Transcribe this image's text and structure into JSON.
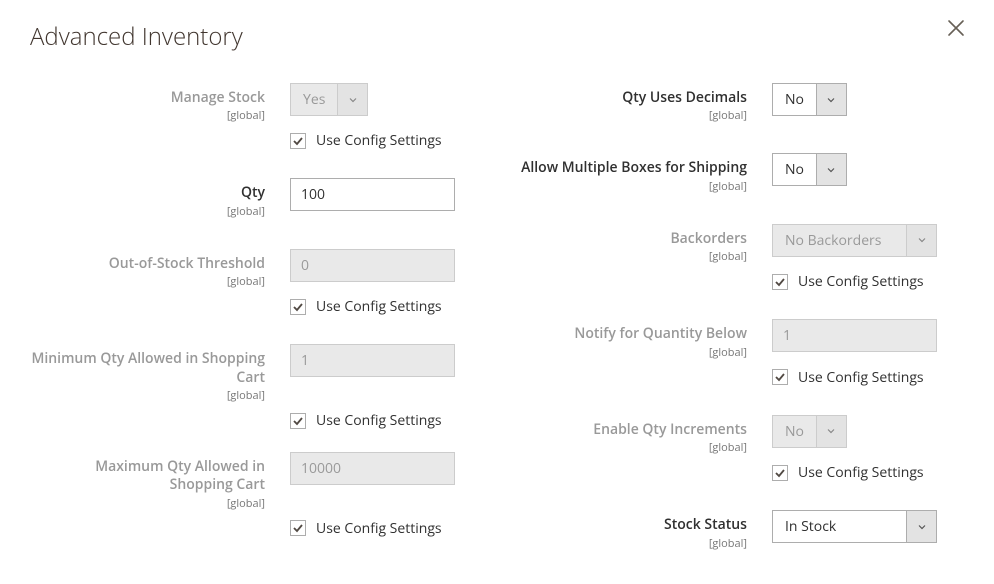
{
  "modal": {
    "title": "Advanced Inventory"
  },
  "common": {
    "scope": "[global]",
    "use_config": "Use Config Settings"
  },
  "left": {
    "manage_stock": {
      "label": "Manage Stock",
      "value": "Yes"
    },
    "qty": {
      "label": "Qty",
      "value": "100"
    },
    "out_of_stock_threshold": {
      "label": "Out-of-Stock Threshold",
      "value": "0"
    },
    "min_qty_cart": {
      "label": "Minimum Qty Allowed in Shopping Cart",
      "value": "1"
    },
    "max_qty_cart": {
      "label": "Maximum Qty Allowed in Shopping Cart",
      "value": "10000"
    }
  },
  "right": {
    "qty_decimals": {
      "label": "Qty Uses Decimals",
      "value": "No"
    },
    "multi_boxes": {
      "label": "Allow Multiple Boxes for Shipping",
      "value": "No"
    },
    "backorders": {
      "label": "Backorders",
      "value": "No Backorders"
    },
    "notify_below": {
      "label": "Notify for Quantity Below",
      "value": "1"
    },
    "qty_increments": {
      "label": "Enable Qty Increments",
      "value": "No"
    },
    "stock_status": {
      "label": "Stock Status",
      "value": "In Stock"
    }
  }
}
